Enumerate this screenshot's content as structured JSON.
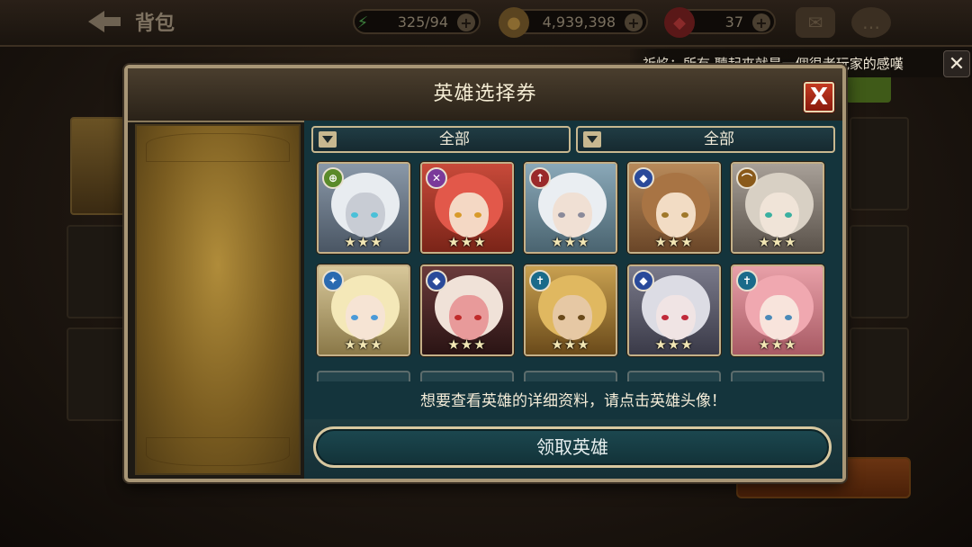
{
  "header": {
    "back_label": "背包",
    "stamina": "325/94",
    "gold": "4,939,398",
    "gems": "37",
    "plus": "+"
  },
  "notification": {
    "text": "祈焰：所有 聽起來就是一個很老玩家的感嘆",
    "close": "✕"
  },
  "dialog": {
    "title": "英雄选择券",
    "close": "X",
    "filter_left": "全部",
    "filter_right": "全部",
    "hint": "想要查看英雄的详细资料，请点击英雄头像！",
    "claim_button": "领取英雄"
  },
  "heroes": [
    {
      "class_icon": "warrior-icon",
      "class_glyph": "⊕",
      "stars": "★★★"
    },
    {
      "class_icon": "assassin-icon",
      "class_glyph": "✕",
      "stars": "★★★"
    },
    {
      "class_icon": "sniper-icon",
      "class_glyph": "↑",
      "stars": "★★★"
    },
    {
      "class_icon": "knight-icon",
      "class_glyph": "◆",
      "stars": "★★★"
    },
    {
      "class_icon": "archer-icon",
      "class_glyph": "⌒",
      "stars": "★★★"
    },
    {
      "class_icon": "mage-icon",
      "class_glyph": "✦",
      "stars": "★★★"
    },
    {
      "class_icon": "knight-icon",
      "class_glyph": "◆",
      "stars": "★★★"
    },
    {
      "class_icon": "priest-icon",
      "class_glyph": "✝",
      "stars": "★★★"
    },
    {
      "class_icon": "knight-icon",
      "class_glyph": "◆",
      "stars": "★★★"
    },
    {
      "class_icon": "priest-icon",
      "class_glyph": "✝",
      "stars": "★★★"
    }
  ],
  "colors": {
    "warrior": "#5a8a2a",
    "assassin": "#7a3a9a",
    "sniper": "#9a2a2a",
    "knight": "#2a4a9a",
    "archer": "#8a5a1a",
    "mage": "#2a6ab0",
    "priest": "#1a6a8a"
  }
}
